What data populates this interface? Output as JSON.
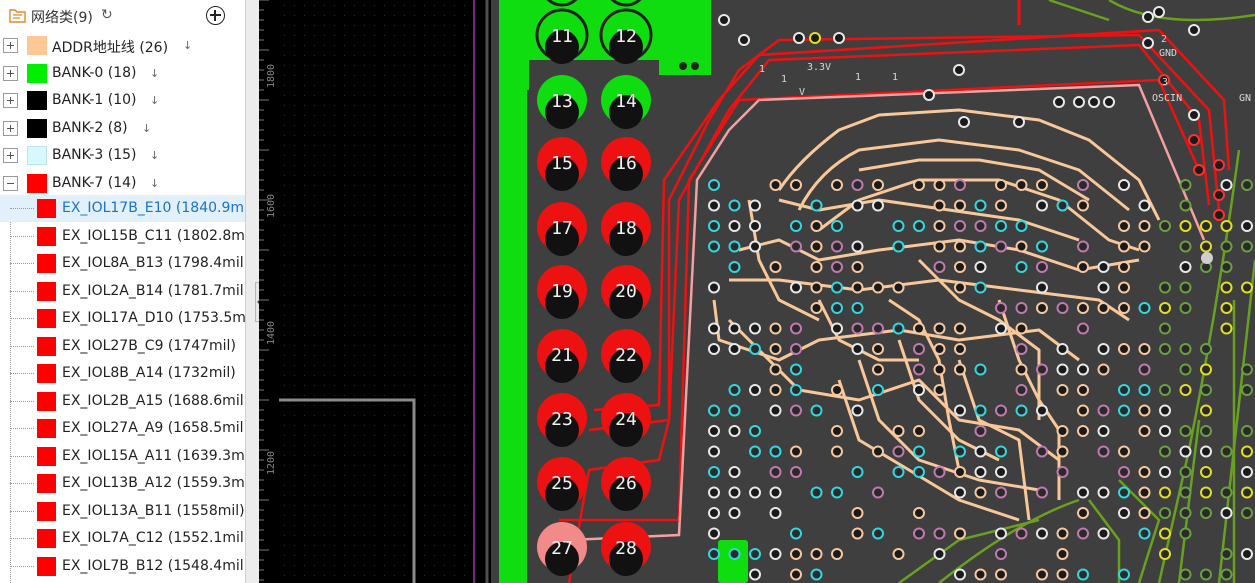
{
  "panel": {
    "title": "网络类(9)",
    "refresh_icon": "refresh-icon",
    "add_icon": "add-circle-icon",
    "groups": [
      {
        "label": "ADDR地址线 (26)",
        "color": "#fcc896",
        "expanded": false
      },
      {
        "label": "BANK-0 (18)",
        "color": "#00ee00",
        "expanded": false
      },
      {
        "label": "BANK-1 (10)",
        "color": "#000000",
        "expanded": false
      },
      {
        "label": "BANK-2 (8)",
        "color": "#000000",
        "expanded": false
      },
      {
        "label": "BANK-3 (15)",
        "color": "#d8f8ff",
        "expanded": false
      },
      {
        "label": "BANK-7 (14)",
        "color": "#ff0000",
        "expanded": true
      }
    ],
    "sort_glyph": "↓",
    "nets": [
      {
        "label": "EX_IOL17B_E10 (1840.9m",
        "selected": true
      },
      {
        "label": "EX_IOL15B_C11 (1802.8m"
      },
      {
        "label": "EX_IOL8A_B13 (1798.4mil"
      },
      {
        "label": "EX_IOL2A_B14 (1781.7mil"
      },
      {
        "label": "EX_IOL17A_D10 (1753.5m"
      },
      {
        "label": "EX_IOL27B_C9 (1747mil)"
      },
      {
        "label": "EX_IOL8B_A14 (1732mil)"
      },
      {
        "label": "EX_IOL2B_A15 (1688.6mil"
      },
      {
        "label": "EX_IOL27A_A9 (1658.5mil"
      },
      {
        "label": "EX_IOL15A_A11 (1639.3m"
      },
      {
        "label": "EX_IOL13B_A12 (1559.3m"
      },
      {
        "label": "EX_IOL13A_B11 (1558mil)"
      },
      {
        "label": "EX_IOL7A_C12 (1552.1mil"
      },
      {
        "label": "EX_IOL7B_B12 (1548.4mil"
      }
    ]
  },
  "canvas": {
    "ruler_labels": [
      "1800",
      "1600",
      "1400",
      "1200"
    ],
    "header_pins": [
      "11",
      "12",
      "13",
      "14",
      "15",
      "16",
      "17",
      "18",
      "19",
      "20",
      "21",
      "22",
      "23",
      "24",
      "25",
      "26",
      "27",
      "28"
    ],
    "silk_labels": {
      "pin2": "2",
      "gnd": "GND",
      "pin3": "3",
      "oscin": "OSCIN",
      "gn": "GN",
      "lead": "1",
      "v33": "3.3V",
      "v": "V"
    },
    "colors": {
      "board": "#3f3f3f",
      "copper_green": "#10dd10",
      "net_red": "#ee1111",
      "net_highlight": "#f4a0a0",
      "addr_trace": "#f8c89a",
      "bank0_trace": "#6aa020"
    }
  }
}
